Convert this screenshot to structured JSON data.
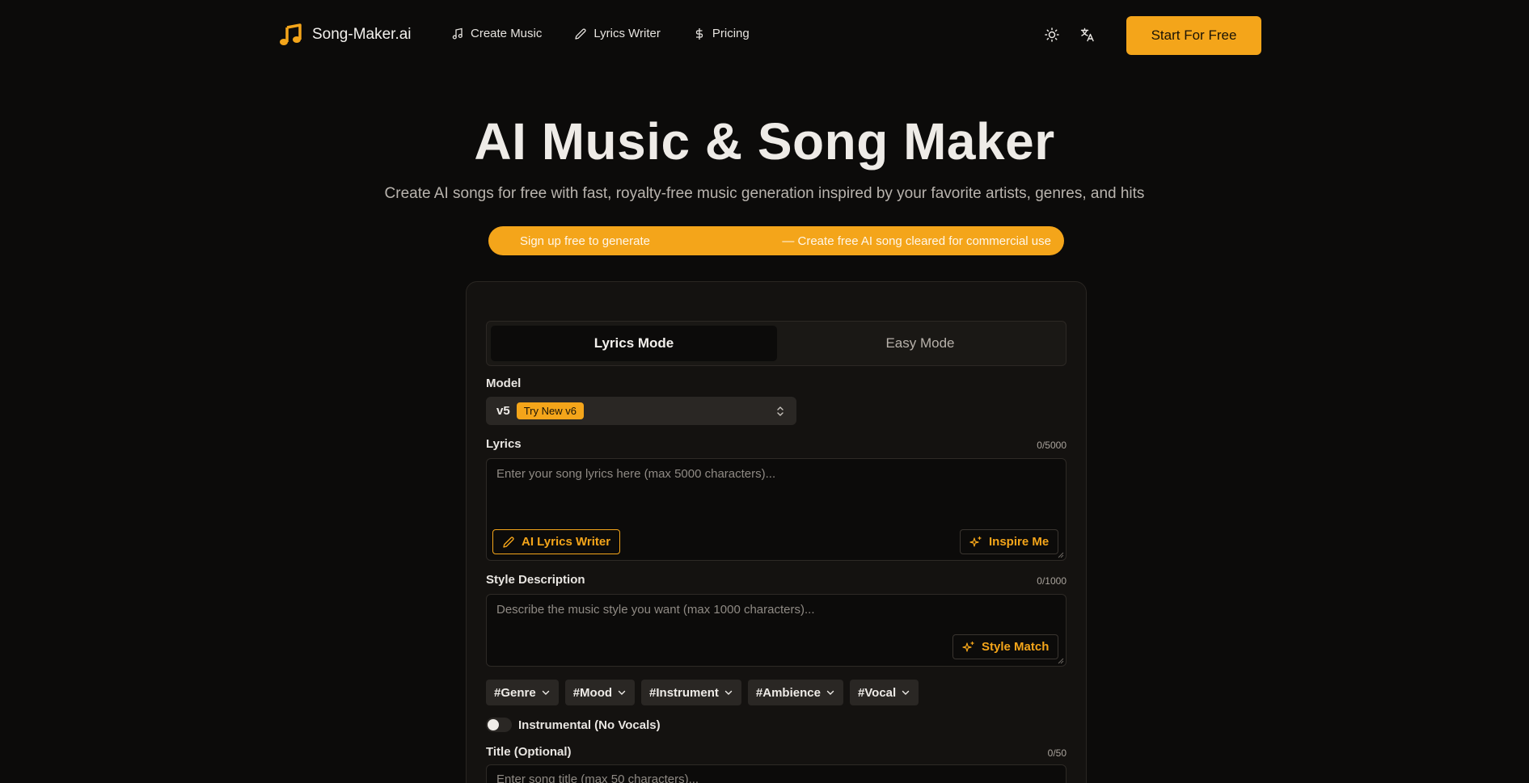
{
  "nav": {
    "brand": "Song-Maker.ai",
    "links": [
      {
        "label": "Create Music",
        "icon": "music-note-icon"
      },
      {
        "label": "Lyrics Writer",
        "icon": "pencil-icon"
      },
      {
        "label": "Pricing",
        "icon": "dollar-icon"
      }
    ],
    "theme_icon": "sun-icon",
    "language_icon": "translate-icon",
    "cta_label": "Start For Free"
  },
  "hero": {
    "title": "AI Music & Song Maker",
    "subtitle": "Create AI songs for free with fast, royalty-free music generation inspired by your favorite artists, genres, and hits"
  },
  "promo": {
    "left_text": "Sign up free to generate",
    "right_text": "— Create free AI song cleared for commercial use"
  },
  "tabs": {
    "lyrics_mode": "Lyrics Mode",
    "easy_mode": "Easy Mode",
    "active": "Lyrics Mode"
  },
  "model": {
    "label": "Model",
    "value": "v5",
    "badge": "Try New v6"
  },
  "lyrics": {
    "label": "Lyrics",
    "counter": "0/5000",
    "placeholder": "Enter your song lyrics here (max 5000 characters)...",
    "ai_writer_label": "AI Lyrics Writer",
    "inspire_label": "Inspire Me"
  },
  "style": {
    "label": "Style Description",
    "counter": "0/1000",
    "placeholder": "Describe the music style you want (max 1000 characters)...",
    "match_label": "Style Match"
  },
  "tags": [
    "#Genre",
    "#Mood",
    "#Instrument",
    "#Ambience",
    "#Vocal"
  ],
  "instrumental": {
    "label": "Instrumental (No Vocals)",
    "enabled": false
  },
  "title_field": {
    "label": "Title (Optional)",
    "counter": "0/50",
    "placeholder": "Enter song title (max 50 characters)..."
  },
  "colors": {
    "accent": "#f4a51a",
    "background": "#0c0b0a",
    "card": "#141210"
  }
}
